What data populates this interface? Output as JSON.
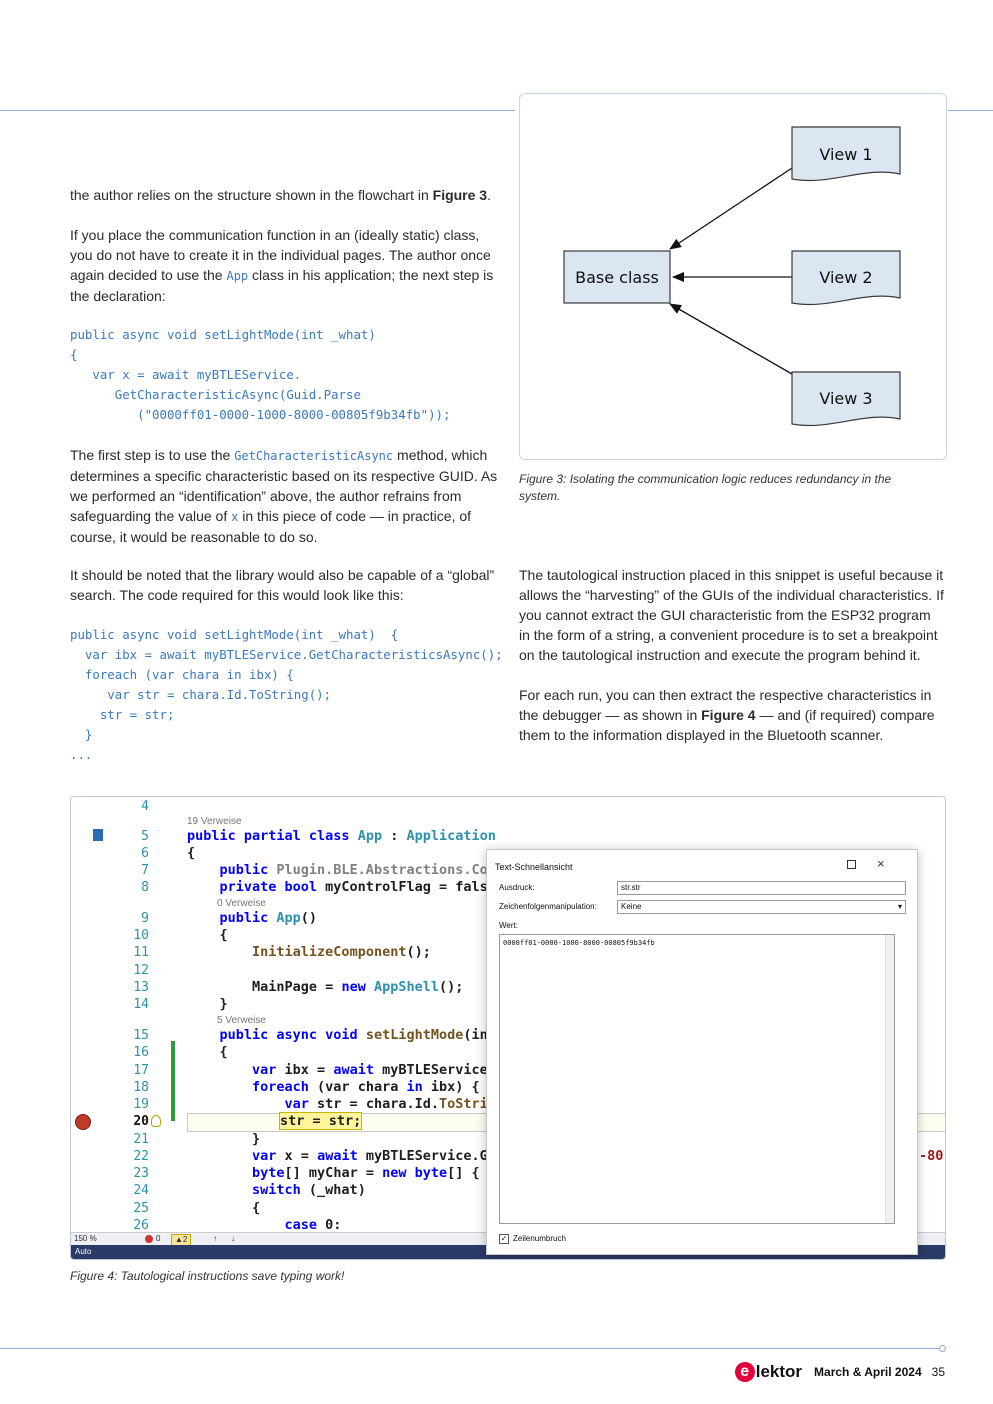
{
  "body": {
    "p1": {
      "before": "the author relies on the structure shown in the flowchart in ",
      "bold": "Figure 3",
      "after": "."
    },
    "p2": {
      "before": "If you place the communication function in an (ideally static) class, you do not have to create it in the individual pages. The author once again decided to use the ",
      "code": "App",
      "after": " class in his application; the next step is the declaration:"
    },
    "code1": [
      "public async void setLightMode(int _what)",
      "{",
      "   var x = await myBTLEService.",
      "      GetCharacteristicAsync(Guid.Parse",
      "         (\"0000ff01-0000-1000-8000-00805f9b34fb\"));"
    ],
    "p3": {
      "a": "The first step is to use the ",
      "code1": "GetCharacteristicAsync",
      "b": " method, which determines a specific characteristic based on its respective GUID. As we performed an “identification” above, the author refrains from safeguarding the value of ",
      "code2": "x",
      "c": " in this piece of code — in practice, of course, it would be reasonable to do so."
    },
    "p4": "It should be noted that the library would also be capable of a “global” search. The code required for this would look like this:",
    "code2": [
      "public async void setLightMode(int _what)  {",
      "  var ibx = await myBTLEService.GetCharacteristicsAsync();",
      "  foreach (var chara in ibx) {",
      "     var str = chara.Id.ToString();",
      "    str = str;",
      "  }",
      "..."
    ],
    "p5": "The tautological instruction placed in this snippet is useful because it allows the “harvesting” of the GUIs of the individual characteristics. If you cannot extract the GUI characteristic from the ESP32 program in the form of a string, a convenient procedure is to set a breakpoint on the tautological instruction and execute the program behind it.",
    "p6": {
      "before": "For each run, you can then extract the respective characteristics in the debugger — as shown in ",
      "bold": "Figure 4",
      "after": " — and (if required) compare them to the information displayed in the Bluetooth scanner."
    }
  },
  "figure3": {
    "base": "Base class",
    "view1": "View 1",
    "view2": "View 2",
    "view3": "View 3",
    "caption": "Figure 3: Isolating the communication logic reduces redundancy in the system."
  },
  "figure4": {
    "caption": "Figure 4: Tautological instructions save typing work!",
    "line_numbers": [
      "4",
      "5",
      "6",
      "7",
      "8",
      "9",
      "10",
      "11",
      "12",
      "13",
      "14",
      "15",
      "16",
      "17",
      "18",
      "19",
      "20",
      "21",
      "22",
      "23",
      "24",
      "25",
      "26"
    ],
    "refs": {
      "r19": "19 Verweise",
      "r0": "0 Verweise",
      "r5": "5 Verweise"
    },
    "lines": {
      "l5a": "public partial class ",
      "l5b": "App",
      "l5c": " : ",
      "l5d": "Application",
      "l6": "{",
      "l7a": "    public ",
      "l7b": "Plugin.BLE.Abstractions.Cont",
      "l8a": "    private bool ",
      "l8b": "myControlFlag = false;",
      "l9a": "    public ",
      "l9b": "App",
      "l9c": "()",
      "l10": "    {",
      "l11a": "        ",
      "l11b": "InitializeComponent",
      "l11c": "();",
      "l13a": "        MainPage = ",
      "l13b": "new ",
      "l13c": "AppShell",
      "l13d": "();",
      "l14": "    }",
      "l15a": "    public async void ",
      "l15b": "setLightMode",
      "l15c": "(int",
      "l16": "    {",
      "l17a": "        var ",
      "l17b": "ibx = ",
      "l17c": "await ",
      "l17d": "myBTLEService.G",
      "l18a": "        foreach ",
      "l18b": "(var ",
      "l18c": "chara ",
      "l18d": "in ",
      "l18e": "ibx) {",
      "l19a": "            var ",
      "l19b": "str = chara.Id.",
      "l19c": "ToString",
      "l20": "str = str;",
      "l21": "        }",
      "l22a": "        var ",
      "l22b": "x = ",
      "l22c": "await ",
      "l22d": "myBTLEService.Get",
      "l23a": "        byte",
      "l23b": "[] myChar = ",
      "l23c": "new byte",
      "l23d": "[] { (b",
      "l24a": "        switch ",
      "l24b": "(_what)",
      "l25": "        {",
      "l26a": "            case ",
      "l26b": "0:"
    },
    "right_fragment": "-80",
    "status": {
      "zoom": "150 %",
      "errors": "0",
      "warnings": "2",
      "mode": "Auto"
    },
    "dialog": {
      "title": "Text-Schnellansicht",
      "expr_label": "Ausdruck:",
      "expr_value": "str.str",
      "manip_label": "Zeichenfolgenmanipulation:",
      "manip_value": "Keine",
      "value_label": "Wert:",
      "value": "0000ff01-0000-1000-8000-00805f9b34fb",
      "wrap_label": "Zeilenumbruch"
    }
  },
  "footer": {
    "brand": "lektor",
    "issue": "March & April 2024",
    "page": "35"
  }
}
